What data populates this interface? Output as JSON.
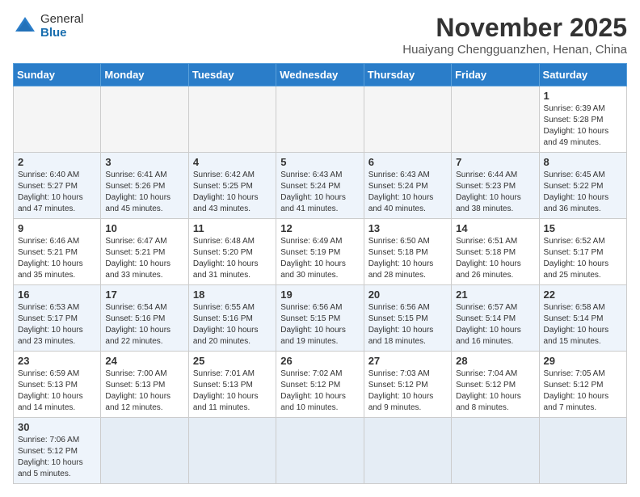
{
  "header": {
    "logo_general": "General",
    "logo_blue": "Blue",
    "month_title": "November 2025",
    "location": "Huaiyang Chengguanzhen, Henan, China"
  },
  "weekdays": [
    "Sunday",
    "Monday",
    "Tuesday",
    "Wednesday",
    "Thursday",
    "Friday",
    "Saturday"
  ],
  "weeks": [
    [
      {
        "day": "",
        "info": ""
      },
      {
        "day": "",
        "info": ""
      },
      {
        "day": "",
        "info": ""
      },
      {
        "day": "",
        "info": ""
      },
      {
        "day": "",
        "info": ""
      },
      {
        "day": "",
        "info": ""
      },
      {
        "day": "1",
        "info": "Sunrise: 6:39 AM\nSunset: 5:28 PM\nDaylight: 10 hours\nand 49 minutes."
      }
    ],
    [
      {
        "day": "2",
        "info": "Sunrise: 6:40 AM\nSunset: 5:27 PM\nDaylight: 10 hours\nand 47 minutes."
      },
      {
        "day": "3",
        "info": "Sunrise: 6:41 AM\nSunset: 5:26 PM\nDaylight: 10 hours\nand 45 minutes."
      },
      {
        "day": "4",
        "info": "Sunrise: 6:42 AM\nSunset: 5:25 PM\nDaylight: 10 hours\nand 43 minutes."
      },
      {
        "day": "5",
        "info": "Sunrise: 6:43 AM\nSunset: 5:24 PM\nDaylight: 10 hours\nand 41 minutes."
      },
      {
        "day": "6",
        "info": "Sunrise: 6:43 AM\nSunset: 5:24 PM\nDaylight: 10 hours\nand 40 minutes."
      },
      {
        "day": "7",
        "info": "Sunrise: 6:44 AM\nSunset: 5:23 PM\nDaylight: 10 hours\nand 38 minutes."
      },
      {
        "day": "8",
        "info": "Sunrise: 6:45 AM\nSunset: 5:22 PM\nDaylight: 10 hours\nand 36 minutes."
      }
    ],
    [
      {
        "day": "9",
        "info": "Sunrise: 6:46 AM\nSunset: 5:21 PM\nDaylight: 10 hours\nand 35 minutes."
      },
      {
        "day": "10",
        "info": "Sunrise: 6:47 AM\nSunset: 5:21 PM\nDaylight: 10 hours\nand 33 minutes."
      },
      {
        "day": "11",
        "info": "Sunrise: 6:48 AM\nSunset: 5:20 PM\nDaylight: 10 hours\nand 31 minutes."
      },
      {
        "day": "12",
        "info": "Sunrise: 6:49 AM\nSunset: 5:19 PM\nDaylight: 10 hours\nand 30 minutes."
      },
      {
        "day": "13",
        "info": "Sunrise: 6:50 AM\nSunset: 5:18 PM\nDaylight: 10 hours\nand 28 minutes."
      },
      {
        "day": "14",
        "info": "Sunrise: 6:51 AM\nSunset: 5:18 PM\nDaylight: 10 hours\nand 26 minutes."
      },
      {
        "day": "15",
        "info": "Sunrise: 6:52 AM\nSunset: 5:17 PM\nDaylight: 10 hours\nand 25 minutes."
      }
    ],
    [
      {
        "day": "16",
        "info": "Sunrise: 6:53 AM\nSunset: 5:17 PM\nDaylight: 10 hours\nand 23 minutes."
      },
      {
        "day": "17",
        "info": "Sunrise: 6:54 AM\nSunset: 5:16 PM\nDaylight: 10 hours\nand 22 minutes."
      },
      {
        "day": "18",
        "info": "Sunrise: 6:55 AM\nSunset: 5:16 PM\nDaylight: 10 hours\nand 20 minutes."
      },
      {
        "day": "19",
        "info": "Sunrise: 6:56 AM\nSunset: 5:15 PM\nDaylight: 10 hours\nand 19 minutes."
      },
      {
        "day": "20",
        "info": "Sunrise: 6:56 AM\nSunset: 5:15 PM\nDaylight: 10 hours\nand 18 minutes."
      },
      {
        "day": "21",
        "info": "Sunrise: 6:57 AM\nSunset: 5:14 PM\nDaylight: 10 hours\nand 16 minutes."
      },
      {
        "day": "22",
        "info": "Sunrise: 6:58 AM\nSunset: 5:14 PM\nDaylight: 10 hours\nand 15 minutes."
      }
    ],
    [
      {
        "day": "23",
        "info": "Sunrise: 6:59 AM\nSunset: 5:13 PM\nDaylight: 10 hours\nand 14 minutes."
      },
      {
        "day": "24",
        "info": "Sunrise: 7:00 AM\nSunset: 5:13 PM\nDaylight: 10 hours\nand 12 minutes."
      },
      {
        "day": "25",
        "info": "Sunrise: 7:01 AM\nSunset: 5:13 PM\nDaylight: 10 hours\nand 11 minutes."
      },
      {
        "day": "26",
        "info": "Sunrise: 7:02 AM\nSunset: 5:12 PM\nDaylight: 10 hours\nand 10 minutes."
      },
      {
        "day": "27",
        "info": "Sunrise: 7:03 AM\nSunset: 5:12 PM\nDaylight: 10 hours\nand 9 minutes."
      },
      {
        "day": "28",
        "info": "Sunrise: 7:04 AM\nSunset: 5:12 PM\nDaylight: 10 hours\nand 8 minutes."
      },
      {
        "day": "29",
        "info": "Sunrise: 7:05 AM\nSunset: 5:12 PM\nDaylight: 10 hours\nand 7 minutes."
      }
    ],
    [
      {
        "day": "30",
        "info": "Sunrise: 7:06 AM\nSunset: 5:12 PM\nDaylight: 10 hours\nand 5 minutes."
      },
      {
        "day": "",
        "info": ""
      },
      {
        "day": "",
        "info": ""
      },
      {
        "day": "",
        "info": ""
      },
      {
        "day": "",
        "info": ""
      },
      {
        "day": "",
        "info": ""
      },
      {
        "day": "",
        "info": ""
      }
    ]
  ]
}
